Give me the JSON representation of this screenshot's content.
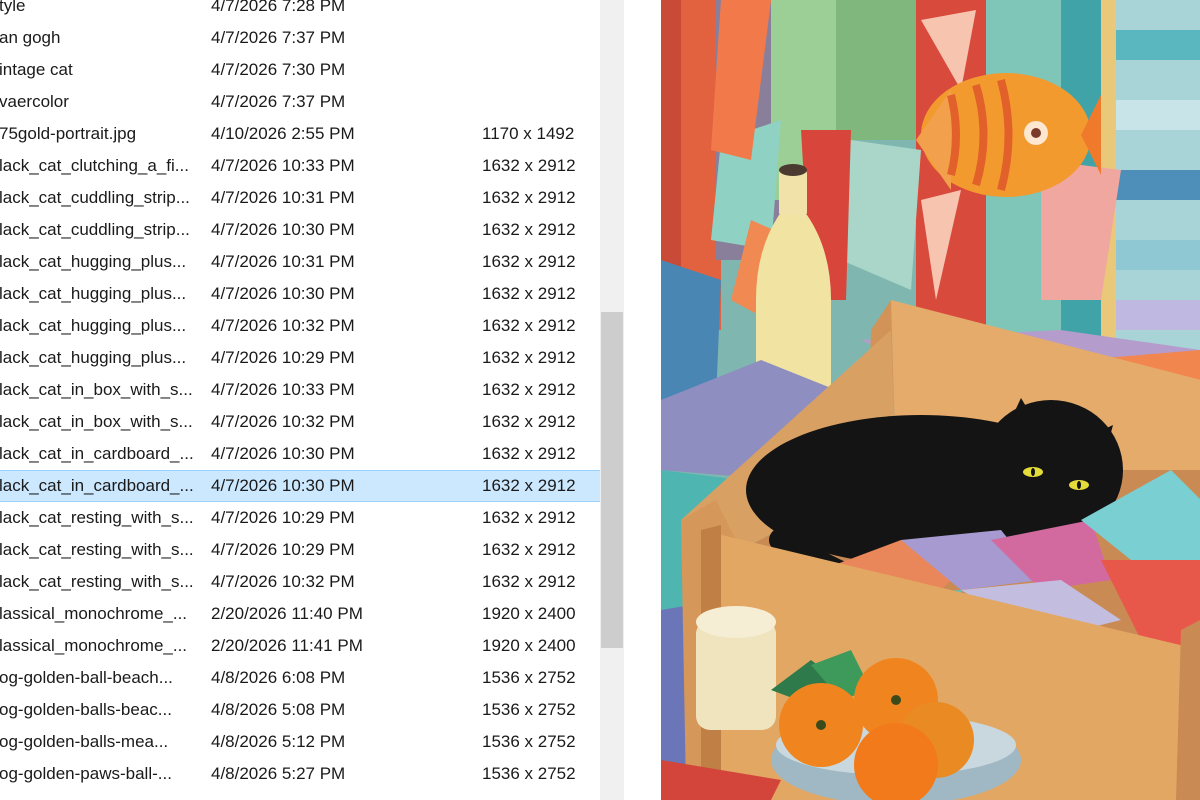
{
  "files": [
    {
      "name": "tyle",
      "date": "4/7/2026 7:28 PM",
      "dimensions": ""
    },
    {
      "name": "an gogh",
      "date": "4/7/2026 7:37 PM",
      "dimensions": ""
    },
    {
      "name": "intage cat",
      "date": "4/7/2026 7:30 PM",
      "dimensions": ""
    },
    {
      "name": "vaercolor",
      "date": "4/7/2026 7:37 PM",
      "dimensions": ""
    },
    {
      "name": "75gold-portrait.jpg",
      "date": "4/10/2026 2:55 PM",
      "dimensions": "1170 x 1492"
    },
    {
      "name": "lack_cat_clutching_a_fi...",
      "date": "4/7/2026 10:33 PM",
      "dimensions": "1632 x 2912"
    },
    {
      "name": "lack_cat_cuddling_strip...",
      "date": "4/7/2026 10:31 PM",
      "dimensions": "1632 x 2912"
    },
    {
      "name": "lack_cat_cuddling_strip...",
      "date": "4/7/2026 10:30 PM",
      "dimensions": "1632 x 2912"
    },
    {
      "name": "lack_cat_hugging_plus...",
      "date": "4/7/2026 10:31 PM",
      "dimensions": "1632 x 2912"
    },
    {
      "name": "lack_cat_hugging_plus...",
      "date": "4/7/2026 10:30 PM",
      "dimensions": "1632 x 2912"
    },
    {
      "name": "lack_cat_hugging_plus...",
      "date": "4/7/2026 10:32 PM",
      "dimensions": "1632 x 2912"
    },
    {
      "name": "lack_cat_hugging_plus...",
      "date": "4/7/2026 10:29 PM",
      "dimensions": "1632 x 2912"
    },
    {
      "name": "lack_cat_in_box_with_s...",
      "date": "4/7/2026 10:33 PM",
      "dimensions": "1632 x 2912"
    },
    {
      "name": "lack_cat_in_box_with_s...",
      "date": "4/7/2026 10:32 PM",
      "dimensions": "1632 x 2912"
    },
    {
      "name": "lack_cat_in_cardboard_...",
      "date": "4/7/2026 10:30 PM",
      "dimensions": "1632 x 2912"
    },
    {
      "name": "lack_cat_in_cardboard_...",
      "date": "4/7/2026 10:30 PM",
      "dimensions": "1632 x 2912",
      "selected": true
    },
    {
      "name": "lack_cat_resting_with_s...",
      "date": "4/7/2026 10:29 PM",
      "dimensions": "1632 x 2912"
    },
    {
      "name": "lack_cat_resting_with_s...",
      "date": "4/7/2026 10:29 PM",
      "dimensions": "1632 x 2912"
    },
    {
      "name": "lack_cat_resting_with_s...",
      "date": "4/7/2026 10:32 PM",
      "dimensions": "1632 x 2912"
    },
    {
      "name": "lassical_monochrome_...",
      "date": "2/20/2026 11:40 PM",
      "dimensions": "1920 x 2400"
    },
    {
      "name": "lassical_monochrome_...",
      "date": "2/20/2026 11:41 PM",
      "dimensions": "1920 x 2400"
    },
    {
      "name": "og-golden-ball-beach...",
      "date": "4/8/2026 6:08 PM",
      "dimensions": "1536 x 2752"
    },
    {
      "name": "og-golden-balls-beac...",
      "date": "4/8/2026 5:08 PM",
      "dimensions": "1536 x 2752"
    },
    {
      "name": "og-golden-balls-mea...",
      "date": "4/8/2026 5:12 PM",
      "dimensions": "1536 x 2752"
    },
    {
      "name": "og-golden-paws-ball-...",
      "date": "4/8/2026 5:27 PM",
      "dimensions": "1536 x 2752"
    },
    {
      "name": "",
      "date": "",
      "dimensions": ""
    }
  ],
  "preview_image": "painting-of-black-cat-in-cardboard-box"
}
